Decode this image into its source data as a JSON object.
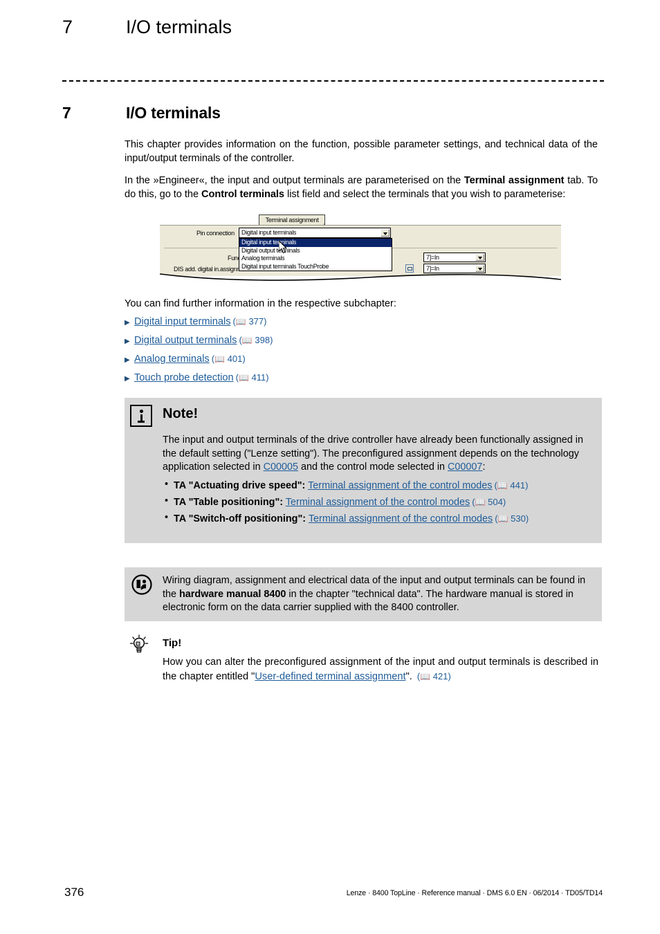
{
  "running_header": {
    "number": "7",
    "title": "I/O terminals"
  },
  "chapter": {
    "number": "7",
    "title": "I/O terminals"
  },
  "intro": {
    "para1": "This chapter provides information on the function, possible parameter settings, and technical data of the input/output terminals of the controller.",
    "para2_a": "In the »Engineer«, the input and output terminals are parameterised on the ",
    "para2_b": "Terminal assignment",
    "para2_c": " tab. To do this, go to the ",
    "para2_d": "Control terminals",
    "para2_e": " list field and select the terminals that you wish to parameterise:"
  },
  "figure": {
    "tab_label": "Terminal assignment",
    "pin_connection_label": "Pin connection",
    "pin_connection_value": "Digital input terminals",
    "function_label": "Function",
    "dis_label": "DIS add. digital in.assignment",
    "dropdown_options": [
      "Digital input terminals",
      "Digital output terminals",
      "Analog terminals",
      "Digital input terminals TouchProbe"
    ],
    "selected_index": 0,
    "field1_value": "7]=In",
    "field2_value": "7]=In",
    "highlight_color": "#0a246a",
    "dialog_bg": "#ece9d8"
  },
  "subchapters": {
    "intro": "You can find further information in the respective subchapter:",
    "items": [
      {
        "label": "Digital input terminals",
        "page": "377"
      },
      {
        "label": "Digital output terminals",
        "page": "398"
      },
      {
        "label": "Analog terminals",
        "page": "401"
      },
      {
        "label": "Touch probe detection",
        "page": "411"
      }
    ],
    "bullet_icon": "triangle-right-icon",
    "page_icon": "book-icon"
  },
  "note_box": {
    "icon": "info-icon",
    "heading": "Note!",
    "text_a": "The input and output terminals of the drive controller have already been functionally assigned in the default setting (\"Lenze setting\"). The preconfigured assignment depends on the technology application selected in ",
    "link1": "C00005",
    "text_b": " and the control mode selected in ",
    "link2": "C00007",
    "text_c": ":",
    "items": [
      {
        "label": "TA \"Actuating drive speed\":",
        "link": "Terminal assignment of the control modes",
        "page": "441"
      },
      {
        "label": "TA \"Table positioning\":",
        "link": "Terminal assignment of the control modes",
        "page": "504"
      },
      {
        "label": "TA \"Switch-off positioning\":",
        "link": "Terminal assignment of the control modes",
        "page": "530"
      }
    ],
    "bg": "#d6d6d6"
  },
  "hw_box": {
    "icon": "read-manual-icon",
    "text_a": "Wiring diagram, assignment and electrical data of the input and output terminals can be found in the ",
    "bold": "hardware manual 8400",
    "text_b": " in the chapter \"technical data\". The hardware manual is stored in electronic form on the data carrier supplied with the 8400 controller.",
    "bg": "#d6d6d6"
  },
  "tip_box": {
    "icon": "lightbulb-icon",
    "heading": "Tip!",
    "text_a": "How you can alter the preconfigured assignment of the input and output terminals is described in the chapter entitled \"",
    "link": "User-defined terminal assignment",
    "text_b": "\". ",
    "page": "421"
  },
  "footer": {
    "page_number": "376",
    "text": "Lenze · 8400 TopLine · Reference manual · DMS 6.0 EN · 06/2014 · TD05/TD14"
  },
  "colors": {
    "link": "#1f5c99",
    "bullet": "#1f4e79"
  }
}
